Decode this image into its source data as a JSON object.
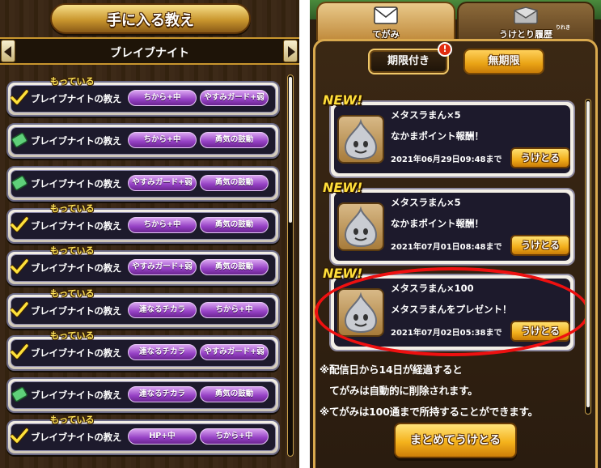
{
  "left_panel": {
    "title": "手に入る教え",
    "subtitle": "ブレイブナイト",
    "owned_label": "もっている",
    "rows": [
      {
        "owned": true,
        "label": "ブレイブナイトの教え",
        "skill1": "ちから+中",
        "skill2": "やすみガード+弱"
      },
      {
        "owned": false,
        "label": "ブレイブナイトの教え",
        "skill1": "ちから+中",
        "skill2": "勇気の鼓動"
      },
      {
        "owned": false,
        "label": "ブレイブナイトの教え",
        "skill1": "やすみガード+弱",
        "skill2": "勇気の鼓動"
      },
      {
        "owned": true,
        "label": "ブレイブナイトの教え",
        "skill1": "ちから+中",
        "skill2": "勇気の鼓動"
      },
      {
        "owned": true,
        "label": "ブレイブナイトの教え",
        "skill1": "やすみガード+弱",
        "skill2": "勇気の鼓動"
      },
      {
        "owned": true,
        "label": "ブレイブナイトの教え",
        "skill1": "連なるチカラ",
        "skill2": "ちから+中"
      },
      {
        "owned": true,
        "label": "ブレイブナイトの教え",
        "skill1": "連なるチカラ",
        "skill2": "やすみガード+弱"
      },
      {
        "owned": false,
        "label": "ブレイブナイトの教え",
        "skill1": "連なるチカラ",
        "skill2": "勇気の鼓動"
      },
      {
        "owned": true,
        "label": "ブレイブナイトの教え",
        "skill1": "HP+中",
        "skill2": "ちから+中"
      }
    ]
  },
  "right_panel": {
    "tabs": [
      {
        "label": "てがみ",
        "icon": "envelope-icon"
      },
      {
        "label": "うけとり履歴",
        "ruby": "りれき",
        "icon": "received-envelope-icon"
      }
    ],
    "filters": {
      "limited": "期限付き",
      "unlimited": "無期限",
      "alert": "!"
    },
    "new_tag": "NEW!",
    "receive_label": "うけとる",
    "mails": [
      {
        "title": "メタスラまん×5",
        "subtitle": "なかまポイント報酬！",
        "date": "2021年06月29日09:48まで"
      },
      {
        "title": "メタスラまん×5",
        "subtitle": "なかまポイント報酬！",
        "date": "2021年07月01日08:48まで"
      },
      {
        "title": "メタスラまん×100",
        "subtitle": "メタスラまんをプレゼント！",
        "date": "2021年07月02日05:38まで"
      }
    ],
    "notes": [
      "※配信日から14日が経過すると",
      "　てがみは自動的に削除されます。",
      "※てがみは100通まで所持することができます。"
    ],
    "bulk_receive": "まとめてうけとる",
    "colors": {
      "highlight": "#ee1010",
      "gold": "#f4b21c",
      "skill_purple": "#9540c4"
    }
  }
}
